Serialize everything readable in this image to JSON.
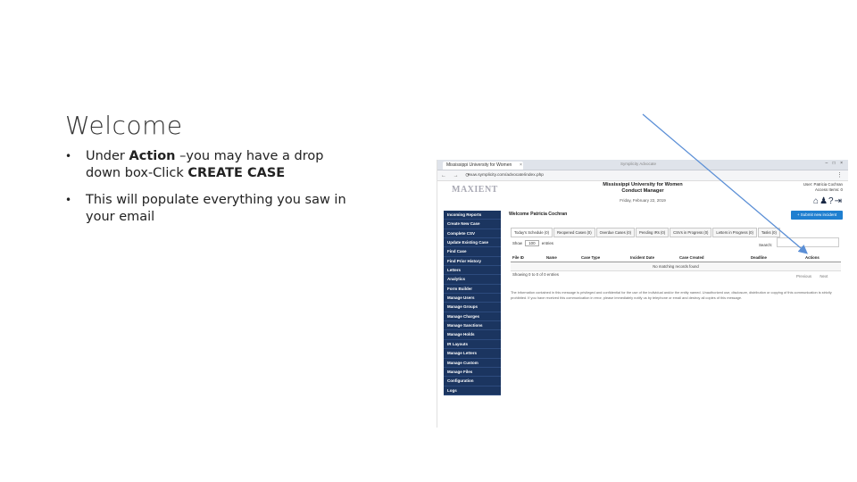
{
  "slide": {
    "title": "Welcome",
    "bullets": [
      {
        "text_before": "Under ",
        "bold1": "Action",
        "text_mid": " –you may have a drop down box-Click ",
        "bold2": "CREATE CASE"
      },
      {
        "text": "This will populate everything you saw in your email"
      }
    ]
  },
  "browser": {
    "tab_title": "Mississippi University for Women",
    "tab_close": "×",
    "window_title": "Symplicity Advocate",
    "window_controls": "– □ ×",
    "url": "muw.symplicity.com/advocate/index.php",
    "nav_icons": "← → ⟳"
  },
  "site": {
    "logo_text": "MAXIENT",
    "title_line1": "Mississippi University for Women",
    "title_line2": "Conduct Manager",
    "date": "Friday, February 22, 2019",
    "user_name": "User: Patricia Cochran",
    "user_access": "Access Items: 0",
    "top_icons": [
      "home-icon",
      "users-icon",
      "help-icon",
      "logout-icon"
    ],
    "external_button": "+ Submit new incident"
  },
  "sidenav": {
    "items": [
      "Incoming Reports",
      "Create New Case",
      "Complete CSV",
      "Update Existing Case",
      "Find Case",
      "Find Prior History",
      "Letters",
      "Analytics",
      "Form Builder",
      "Manage Users",
      "Manage Groups",
      "Manage Charges",
      "Manage Sanctions",
      "Manage Holds",
      "IR Layouts",
      "Manage Letters",
      "Manage Custom",
      "Manage Files",
      "Configuration",
      "Logs"
    ]
  },
  "main": {
    "welcome": "Welcome Patricia Cochran",
    "tabs": [
      "Today's Schedule (0)",
      "Reopened Cases (0)",
      "Overdue Cases (0)",
      "Pending IRs (0)",
      "CSVs in Progress (0)",
      "Letters in Progress (0)",
      "Tasks (0)"
    ],
    "show_label": "Show",
    "show_value": "100",
    "entries_label": "entries",
    "search_label": "Search:",
    "columns": [
      "File ID",
      "Name",
      "Case Type",
      "Incident Date",
      "Case Created",
      "Deadline",
      "Actions"
    ],
    "empty_message": "No matching records found",
    "info": "Showing 0 to 0 of 0 entries",
    "pager_prev": "Previous",
    "pager_next": "Next",
    "footer_note": "The information contained in this message is privileged and confidential for the use of the individual and/or the entity named. Unauthorized use, disclosure, distribution or copying of this communication is strictly prohibited. If you have received this communication in error, please immediately notify us by telephone or email and destroy all copies of this message."
  },
  "colors": {
    "sidebar_bg": "#1b3560",
    "button_blue": "#1f7fd0",
    "arrow": "#5b8fd6"
  }
}
